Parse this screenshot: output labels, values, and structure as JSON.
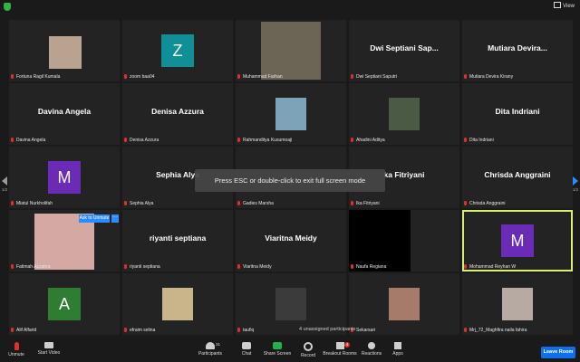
{
  "header": {
    "view_label": "View"
  },
  "overlay_message": "Press ESC or double-click to exit full screen mode",
  "pager": {
    "left_label": "1/2",
    "right_label": "1/2"
  },
  "tiles": [
    {
      "display": "photo",
      "label": "Fortuna Ragil Kumala",
      "photo_color": "#b9a28f"
    },
    {
      "display": "avatar",
      "avatar_letter": "Z",
      "avatar_color": "#0f8f96",
      "label": "zoom baa04"
    },
    {
      "display": "photo",
      "label": "Muhammad Farhan",
      "photo_color": "#6c6455"
    },
    {
      "display": "name",
      "title": "Dwi Septiani Sap...",
      "label": "Dwi Septiani Saputri"
    },
    {
      "display": "name",
      "title": "Mutiara Devira...",
      "label": "Mutiara Devira Kirany"
    },
    {
      "display": "name",
      "title": "Davina Angela",
      "label": "Davina Angela"
    },
    {
      "display": "name",
      "title": "Denisa Azzura",
      "label": "Denisa Azzura"
    },
    {
      "display": "photo",
      "label": "Rahmanditya Kusumoaji",
      "photo_color": "#7da3b8"
    },
    {
      "display": "photo",
      "label": "Ahadini Aditya",
      "photo_color": "#4b5a44"
    },
    {
      "display": "name",
      "title": "Dita Indriani",
      "label": "Dita Indriani"
    },
    {
      "display": "avatar",
      "avatar_letter": "M",
      "avatar_color": "#6a2bb6",
      "label": "Miatul Nurkholifah"
    },
    {
      "display": "name",
      "title": "Sephia Alya",
      "label": "Sephia Alya"
    },
    {
      "display": "name",
      "title": "",
      "label": "Gadies Marsha"
    },
    {
      "display": "name",
      "title": "ka Fitriyani",
      "label": "Ika Fitriyani"
    },
    {
      "display": "name",
      "title": "Chrisda Anggraini",
      "label": "Chrisda Anggraini"
    },
    {
      "display": "photo",
      "label": "Fatimah Azzahra",
      "photo_color": "#d4a9a3"
    },
    {
      "display": "name",
      "title": "riyanti septiana",
      "label": "riyanti septiana"
    },
    {
      "display": "name",
      "title": "Viaritna Meidy",
      "label": "Viaritna Meidy"
    },
    {
      "display": "photo",
      "label": "Naufa Regiana",
      "photo_color": "#000000"
    },
    {
      "display": "avatar",
      "avatar_letter": "M",
      "avatar_color": "#6a2bb6",
      "label": "Mohammad Reyhan W",
      "active": true
    },
    {
      "display": "avatar",
      "avatar_letter": "A",
      "avatar_color": "#2e7d32",
      "label": "Alif Alfarid"
    },
    {
      "display": "photo",
      "label": "efraim selina",
      "photo_color": "#c9b58a"
    },
    {
      "display": "photo",
      "label": "taufiq",
      "photo_color": "#3b3b3b"
    },
    {
      "display": "photo",
      "label": "Sekarsari",
      "photo_color": "#a57b6a"
    },
    {
      "display": "photo",
      "label": "Mrj_72_Maghfira naila fahira",
      "photo_color": "#b7aaa2"
    }
  ],
  "ask_to_unmute": "Ask to Unmute",
  "more_symbol": "···",
  "unassigned_text": "4 unassigned participants",
  "toolbar": {
    "unmute": "Unmute",
    "start_video": "Start Video",
    "participants": "Participants",
    "participants_count": "31",
    "chat": "Chat",
    "share_screen": "Share Screen",
    "record": "Record",
    "breakout_rooms": "Breakout Rooms",
    "breakout_badge": "4",
    "reactions": "Reactions",
    "apps": "Apps",
    "leave_room": "Leave Room"
  }
}
